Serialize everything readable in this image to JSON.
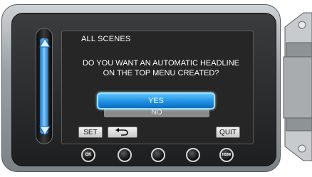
{
  "dialog": {
    "title": "ALL SCENES",
    "question": "DO YOU WANT AN AUTOMATIC HEADLINE ON THE TOP MENU CREATED?",
    "options": [
      "YES",
      "NO"
    ],
    "selected": "YES"
  },
  "buttons": {
    "set": "SET",
    "quit": "QUIT"
  },
  "bottom_controls": {
    "ok": "OK",
    "hdmi": "HDMI"
  }
}
